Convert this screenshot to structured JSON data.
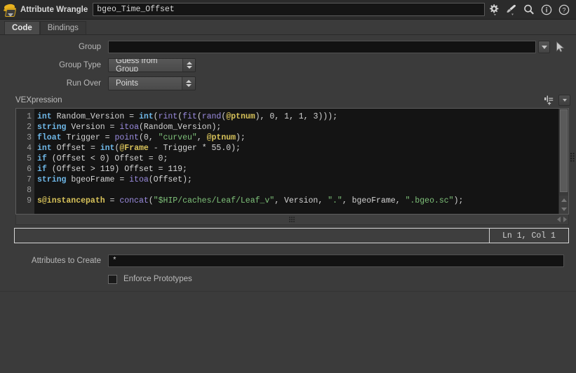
{
  "window": {
    "node_icon": "wrangle-node-icon",
    "node_type_label": "Attribute Wrangle",
    "node_name": "bgeo_Time_Offset",
    "icons": [
      {
        "name": "gear-icon",
        "label": "gear"
      },
      {
        "name": "paintbrush-icon",
        "label": "paintbrush"
      },
      {
        "name": "search-icon",
        "label": "search"
      },
      {
        "name": "info-icon",
        "label": "info"
      },
      {
        "name": "help-icon",
        "label": "help"
      }
    ]
  },
  "tabs": [
    {
      "label": "Code",
      "active": true
    },
    {
      "label": "Bindings",
      "active": false
    }
  ],
  "params": {
    "group": {
      "label": "Group",
      "value": "",
      "dropdown": "chevron-down-icon",
      "picker": "pointer-arrow-icon"
    },
    "group_type": {
      "label": "Group Type",
      "value": "Guess from Group"
    },
    "run_over": {
      "label": "Run Over",
      "value": "Points"
    },
    "attributes_to_create": {
      "label": "Attributes to Create",
      "value": "*"
    },
    "enforce_prototypes": {
      "label": "Enforce Prototypes",
      "checked": false
    }
  },
  "vexpression": {
    "title": "VEXpression",
    "chop_icon": "channel-keyframe-icon",
    "dropdown_icon": "chevron-down-icon",
    "line_numbers": [
      "1",
      "2",
      "3",
      "4",
      "5",
      "6",
      "7",
      "8",
      "9"
    ],
    "lines": [
      [
        {
          "t": "int",
          "c": "kw"
        },
        {
          "t": " Random_Version ",
          "c": "pl"
        },
        {
          "t": "= ",
          "c": "pl"
        },
        {
          "t": "int",
          "c": "kw"
        },
        {
          "t": "(",
          "c": "pl"
        },
        {
          "t": "rint",
          "c": "fn"
        },
        {
          "t": "(",
          "c": "pl"
        },
        {
          "t": "fit",
          "c": "fn"
        },
        {
          "t": "(",
          "c": "pl"
        },
        {
          "t": "rand",
          "c": "fn"
        },
        {
          "t": "(",
          "c": "pl"
        },
        {
          "t": "@ptnum",
          "c": "at"
        },
        {
          "t": "), 0, 1, 1, 3)));",
          "c": "pl"
        }
      ],
      [
        {
          "t": "string",
          "c": "kw"
        },
        {
          "t": " Version ",
          "c": "pl"
        },
        {
          "t": "= ",
          "c": "pl"
        },
        {
          "t": "itoa",
          "c": "fn"
        },
        {
          "t": "(Random_Version);",
          "c": "pl"
        }
      ],
      [
        {
          "t": "float",
          "c": "kw"
        },
        {
          "t": " Trigger ",
          "c": "pl"
        },
        {
          "t": "= ",
          "c": "pl"
        },
        {
          "t": "point",
          "c": "fn"
        },
        {
          "t": "(0, ",
          "c": "pl"
        },
        {
          "t": "\"curveu\"",
          "c": "str"
        },
        {
          "t": ", ",
          "c": "pl"
        },
        {
          "t": "@ptnum",
          "c": "at"
        },
        {
          "t": ");",
          "c": "pl"
        }
      ],
      [
        {
          "t": "int",
          "c": "kw"
        },
        {
          "t": " Offset ",
          "c": "pl"
        },
        {
          "t": "= ",
          "c": "pl"
        },
        {
          "t": "int",
          "c": "kw"
        },
        {
          "t": "(",
          "c": "pl"
        },
        {
          "t": "@Frame",
          "c": "at"
        },
        {
          "t": " - Trigger * 55.0);",
          "c": "pl"
        }
      ],
      [
        {
          "t": "if",
          "c": "kw"
        },
        {
          "t": " (Offset < 0) Offset = 0;",
          "c": "pl"
        }
      ],
      [
        {
          "t": "if",
          "c": "kw"
        },
        {
          "t": " (Offset > 119) Offset = 119;",
          "c": "pl"
        }
      ],
      [
        {
          "t": "string",
          "c": "kw"
        },
        {
          "t": " bgeoFrame ",
          "c": "pl"
        },
        {
          "t": "= ",
          "c": "pl"
        },
        {
          "t": "itoa",
          "c": "fn"
        },
        {
          "t": "(Offset);",
          "c": "pl"
        }
      ],
      [],
      [
        {
          "t": "s@instancepath",
          "c": "at"
        },
        {
          "t": " = ",
          "c": "pl"
        },
        {
          "t": "concat",
          "c": "fn"
        },
        {
          "t": "(",
          "c": "pl"
        },
        {
          "t": "\"$HIP/caches/Leaf/Leaf_v\"",
          "c": "str"
        },
        {
          "t": ", Version, ",
          "c": "pl"
        },
        {
          "t": "\".\"",
          "c": "str"
        },
        {
          "t": ", bgeoFrame, ",
          "c": "pl"
        },
        {
          "t": "\".bgeo.sc\"",
          "c": "str"
        },
        {
          "t": ");",
          "c": "pl"
        }
      ]
    ],
    "plain_text": "int Random_Version = int(rint(fit(rand(@ptnum), 0, 1, 1, 3)));\nstring Version = itoa(Random_Version);\nfloat Trigger = point(0, \"curveu\", @ptnum);\nint Offset = int(@Frame - Trigger * 55.0);\nif (Offset < 0) Offset = 0;\nif (Offset > 119) Offset = 119;\nstring bgeoFrame = itoa(Offset);\n\ns@instancepath = concat(\"$HIP/caches/Leaf/Leaf_v\", Version, \".\", bgeoFrame, \".bgeo.sc\");"
  },
  "status": {
    "message": "",
    "ln_col": "Ln 1, Col 1"
  },
  "colors": {
    "window_bg": "#3b3b3b",
    "titlebar_bg": "#2b2b2b",
    "editor_bg": "#141414",
    "gutter_bg": "#2e2e2e",
    "keyword": "#6fb8e8",
    "function": "#9b8ce0",
    "attribute": "#d8c35a",
    "string": "#7fc27a",
    "plain": "#d4d4d4",
    "accent_icon": "#e8b21f"
  }
}
